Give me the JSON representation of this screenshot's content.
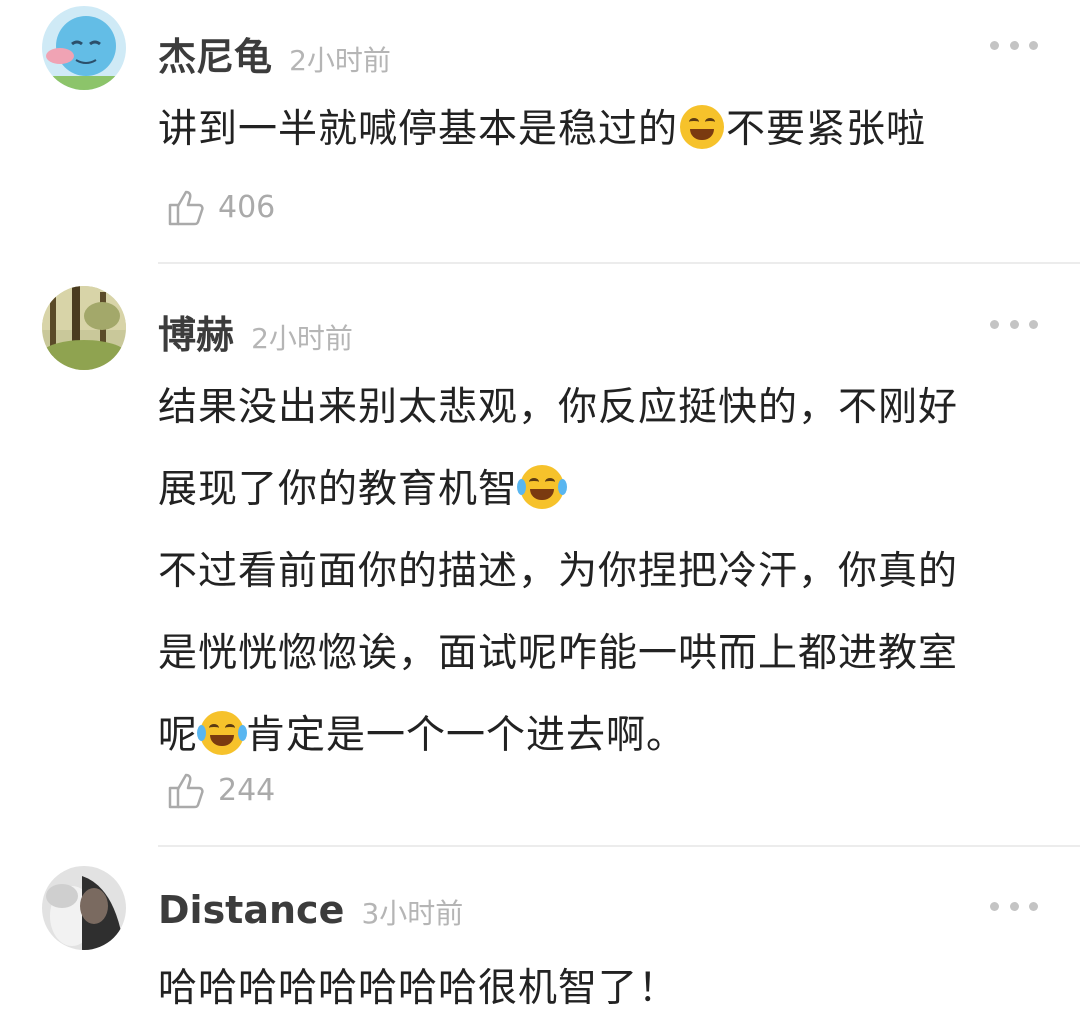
{
  "comments": [
    {
      "username": "杰尼龟",
      "time": "2小时前",
      "lines": [
        [
          "讲到一半就喊停基本是稳过的",
          "不要紧张啦"
        ]
      ],
      "likes": "406",
      "avatar_icon": "squirtle-avatar"
    },
    {
      "username": "博赫",
      "time": "2小时前",
      "lines": [
        [
          "结果没出来别太悲观，你反应挺快的，不刚好"
        ],
        [
          "展现了你的教育机智",
          ""
        ],
        [
          "不过看前面你的描述，为你捏把冷汗，你真的"
        ],
        [
          "是恍恍惚惚诶，面试呢咋能一哄而上都进教室"
        ],
        [
          "呢",
          "肯定是一个一个进去啊。"
        ]
      ],
      "likes": "244",
      "avatar_icon": "forest-avatar"
    },
    {
      "username": "Distance",
      "time": "3小时前",
      "lines": [
        [
          "哈哈哈哈哈哈哈哈很机智了！"
        ]
      ],
      "avatar_icon": "portrait-avatar"
    }
  ],
  "emoji_names": [
    "laughing-emoji",
    "tears-of-joy-emoji",
    "tears-of-joy-emoji"
  ],
  "colors": {
    "username": "#3c3c3c",
    "time": "#b5b5b5",
    "text": "#222222",
    "count": "#aaaaaa",
    "divider": "#ececec"
  }
}
